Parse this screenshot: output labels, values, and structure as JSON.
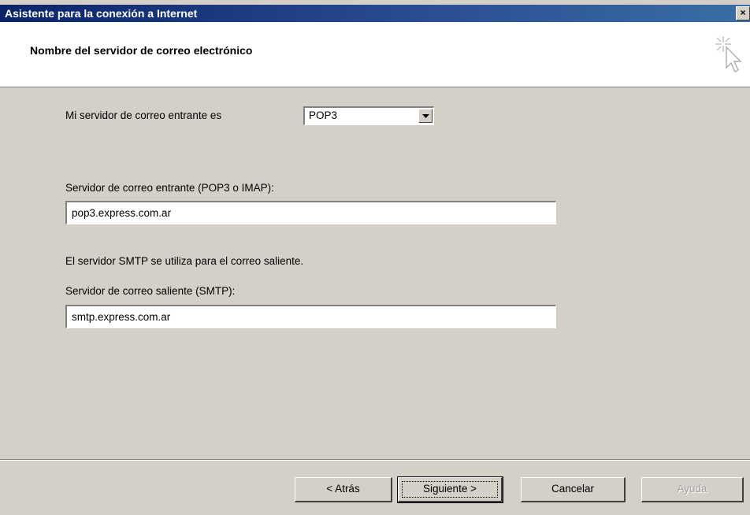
{
  "window": {
    "title": "Asistente para la conexión a Internet",
    "close_glyph": "×"
  },
  "header": {
    "title": "Nombre del servidor de correo electrónico",
    "icon": "wizard-cursor-sparkle-icon"
  },
  "form": {
    "incoming_type_label": "Mi servidor de correo entrante es",
    "incoming_type_value": "POP3",
    "incoming_server_label": "Servidor de correo entrante (POP3 o IMAP):",
    "incoming_server_value": "pop3.express.com.ar",
    "smtp_note": "El servidor SMTP se utiliza para el correo saliente.",
    "outgoing_server_label": "Servidor de correo saliente (SMTP):",
    "outgoing_server_value": "smtp.express.com.ar"
  },
  "buttons": {
    "back": "< Atrás",
    "next": "Siguiente >",
    "cancel": "Cancelar",
    "help": "Ayuda"
  },
  "colors": {
    "titlebar": "#0a246a",
    "face": "#d4d0c8"
  }
}
